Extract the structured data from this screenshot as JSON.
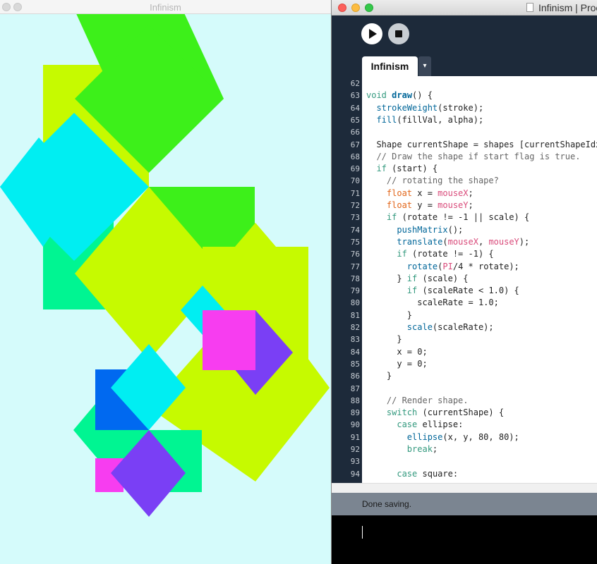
{
  "sketch_window": {
    "title": "Infinism"
  },
  "editor_window": {
    "title": "Infinism | Proc",
    "toolbar": {
      "run": "run",
      "stop": "stop"
    },
    "tabs": [
      {
        "label": "Infinism"
      }
    ],
    "tab_menu_glyph": "▾",
    "code_lines": [
      {
        "n": "62",
        "html": ""
      },
      {
        "n": "63",
        "html": "<span class=\"kw\">void</span> <span class=\"fnb\">draw</span>() {"
      },
      {
        "n": "64",
        "html": "  <span class=\"fn\">strokeWeight</span>(stroke);"
      },
      {
        "n": "65",
        "html": "  <span class=\"fn\">fill</span>(fillVal, alpha);"
      },
      {
        "n": "66",
        "html": ""
      },
      {
        "n": "67",
        "html": "  Shape currentShape = shapes [currentShapeIdx];"
      },
      {
        "n": "68",
        "html": "  <span class=\"cm\">// Draw the shape if start flag is true.</span>"
      },
      {
        "n": "69",
        "html": "  <span class=\"kw\">if</span> (start) {"
      },
      {
        "n": "70",
        "html": "    <span class=\"cm\">// rotating the shape?</span>"
      },
      {
        "n": "71",
        "html": "    <span class=\"ty\">float</span> x = <span class=\"vr\">mouseX</span>;"
      },
      {
        "n": "72",
        "html": "    <span class=\"ty\">float</span> y = <span class=\"vr\">mouseY</span>;"
      },
      {
        "n": "73",
        "html": "    <span class=\"kw\">if</span> (rotate != -1 || scale) {"
      },
      {
        "n": "74",
        "html": "      <span class=\"fn\">pushMatrix</span>();"
      },
      {
        "n": "75",
        "html": "      <span class=\"fn\">translate</span>(<span class=\"vr\">mouseX</span>, <span class=\"vr\">mouseY</span>);"
      },
      {
        "n": "76",
        "html": "      <span class=\"kw\">if</span> (rotate != -1) {"
      },
      {
        "n": "77",
        "html": "        <span class=\"fn\">rotate</span>(<span class=\"vr\">PI</span>/4 * rotate);"
      },
      {
        "n": "78",
        "html": "      } <span class=\"kw\">if</span> (scale) {"
      },
      {
        "n": "79",
        "html": "        <span class=\"kw\">if</span> (scaleRate &lt; 1.0) {"
      },
      {
        "n": "80",
        "html": "          scaleRate = 1.0;"
      },
      {
        "n": "81",
        "html": "        }"
      },
      {
        "n": "82",
        "html": "        <span class=\"fn\">scale</span>(scaleRate);"
      },
      {
        "n": "83",
        "html": "      }"
      },
      {
        "n": "84",
        "html": "      x = 0;"
      },
      {
        "n": "85",
        "html": "      y = 0;"
      },
      {
        "n": "86",
        "html": "    }"
      },
      {
        "n": "87",
        "html": ""
      },
      {
        "n": "88",
        "html": "    <span class=\"cm\">// Render shape.</span>"
      },
      {
        "n": "89",
        "html": "    <span class=\"kw\">switch</span> (currentShape) {"
      },
      {
        "n": "90",
        "html": "      <span class=\"kw\">case</span> ellipse:"
      },
      {
        "n": "91",
        "html": "        <span class=\"fn\">ellipse</span>(x, y, 80, 80);"
      },
      {
        "n": "92",
        "html": "        <span class=\"kw\">break</span>;"
      },
      {
        "n": "93",
        "html": ""
      },
      {
        "n": "94",
        "html": "      <span class=\"kw\">case</span> square:"
      }
    ],
    "status": "Done saving."
  },
  "colors": {
    "canvas_bg": "#d5fbfb",
    "lime": "#c6fa00",
    "green": "#3df01a",
    "cyan": "#00eef2",
    "mint": "#00f592",
    "magenta": "#f73df0",
    "violet": "#7a3ff5",
    "blue": "#0069f0"
  }
}
